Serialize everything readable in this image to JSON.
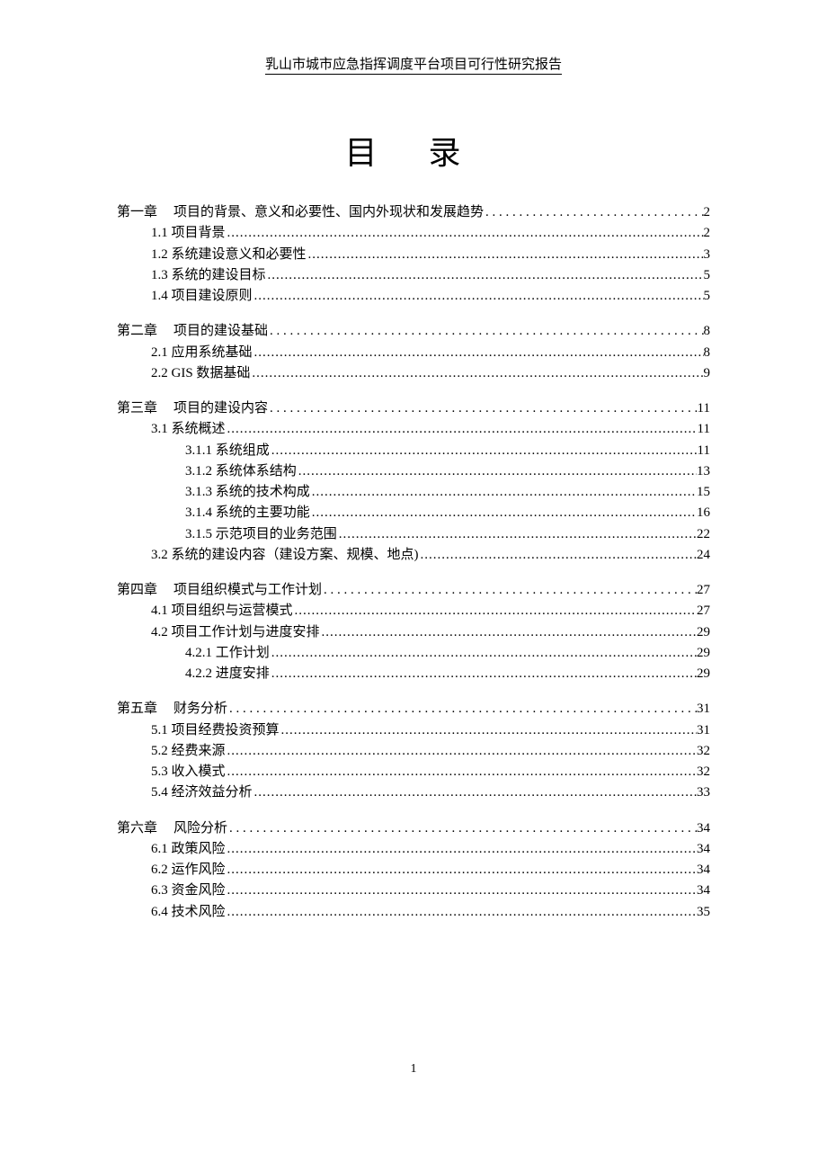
{
  "header": "乳山市城市应急指挥调度平台项目可行性研究报告",
  "title": "目  录",
  "page_number": "1",
  "toc": [
    {
      "chapter": "第一章",
      "title": "项目的背景、意义和必要性、国内外现状和发展趋势",
      "page": "2",
      "items": [
        {
          "label": "1.1 项目背景",
          "page": "2",
          "level": 2
        },
        {
          "label": "1.2 系统建设意义和必要性",
          "page": "3",
          "level": 2
        },
        {
          "label": "1.3 系统的建设目标",
          "page": "5",
          "level": 2
        },
        {
          "label": "1.4 项目建设原则",
          "page": "5",
          "level": 2
        }
      ]
    },
    {
      "chapter": "第二章",
      "title": "项目的建设基础",
      "page": "8",
      "items": [
        {
          "label": "2.1 应用系统基础",
          "page": "8",
          "level": 2
        },
        {
          "label": "2.2 GIS 数据基础",
          "page": "9",
          "level": 2
        }
      ]
    },
    {
      "chapter": "第三章",
      "title": "项目的建设内容",
      "page": "11",
      "items": [
        {
          "label": "3.1 系统概述",
          "page": "11",
          "level": 2
        },
        {
          "label": "3.1.1  系统组成",
          "page": "11",
          "level": 3
        },
        {
          "label": "3.1.2  系统体系结构",
          "page": "13",
          "level": 3
        },
        {
          "label": "3.1.3  系统的技术构成",
          "page": "15",
          "level": 3
        },
        {
          "label": "3.1.4  系统的主要功能",
          "page": "16",
          "level": 3
        },
        {
          "label": "3.1.5 示范项目的业务范围",
          "page": "22",
          "level": 3
        },
        {
          "label": "3.2  系统的建设内容（建设方案、规模、地点)",
          "page": "24",
          "level": 2
        }
      ]
    },
    {
      "chapter": "第四章",
      "title": "项目组织模式与工作计划",
      "page": "27",
      "items": [
        {
          "label": "4.1  项目组织与运营模式",
          "page": "27",
          "level": 2
        },
        {
          "label": "4.2  项目工作计划与进度安排",
          "page": "29",
          "level": 2
        },
        {
          "label": "4.2.1 工作计划",
          "page": "29",
          "level": 3
        },
        {
          "label": "4.2.2 进度安排",
          "page": "29",
          "level": 3
        }
      ]
    },
    {
      "chapter": "第五章",
      "title": "财务分析",
      "page": "31",
      "items": [
        {
          "label": "5.1  项目经费投资预算",
          "page": "31",
          "level": 2
        },
        {
          "label": "5.2  经费来源",
          "page": "32",
          "level": 2
        },
        {
          "label": "5.3 收入模式",
          "page": "32",
          "level": 2
        },
        {
          "label": "5.4  经济效益分析",
          "page": "33",
          "level": 2
        }
      ]
    },
    {
      "chapter": "第六章",
      "title": "风险分析",
      "page": "34",
      "items": [
        {
          "label": "6.1  政策风险",
          "page": "34",
          "level": 2
        },
        {
          "label": "6.2  运作风险",
          "page": "34",
          "level": 2
        },
        {
          "label": "6.3  资金风险",
          "page": "34",
          "level": 2
        },
        {
          "label": "6.4  技术风险",
          "page": "35",
          "level": 2
        }
      ]
    }
  ]
}
